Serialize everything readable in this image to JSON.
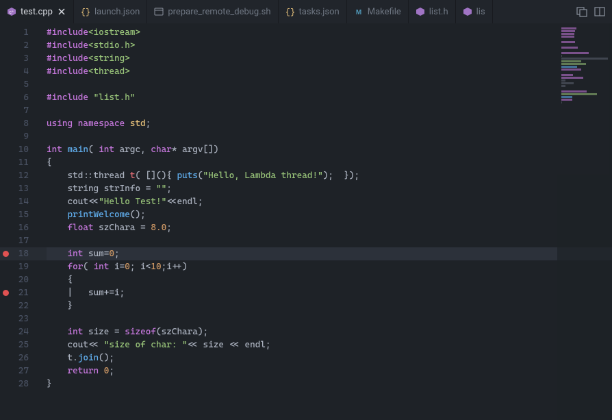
{
  "tabs": [
    {
      "label": "test.cpp",
      "icon": "cpp",
      "active": true,
      "closeable": true
    },
    {
      "label": "launch.json",
      "icon": "json",
      "active": false
    },
    {
      "label": "prepare_remote_debug.sh",
      "icon": "sh",
      "active": false
    },
    {
      "label": "tasks.json",
      "icon": "json",
      "active": false
    },
    {
      "label": "Makefile",
      "icon": "makefile",
      "active": false
    },
    {
      "label": "list.h",
      "icon": "cpp",
      "active": false
    },
    {
      "label": "lis",
      "icon": "cpp",
      "active": false
    }
  ],
  "editor": {
    "active_file": "test.cpp",
    "current_line": 18,
    "breakpoints": [
      18,
      21
    ],
    "line_count": 28,
    "code_lines": [
      {
        "n": 1,
        "tokens": [
          {
            "t": "#include",
            "c": "pre"
          },
          {
            "t": "<iostream>",
            "c": "hdr"
          }
        ]
      },
      {
        "n": 2,
        "tokens": [
          {
            "t": "#include",
            "c": "pre"
          },
          {
            "t": "<stdio.h>",
            "c": "hdr"
          }
        ]
      },
      {
        "n": 3,
        "tokens": [
          {
            "t": "#include",
            "c": "pre"
          },
          {
            "t": "<string>",
            "c": "hdr"
          }
        ]
      },
      {
        "n": 4,
        "tokens": [
          {
            "t": "#include",
            "c": "pre"
          },
          {
            "t": "<thread>",
            "c": "hdr"
          }
        ]
      },
      {
        "n": 5,
        "tokens": []
      },
      {
        "n": 6,
        "tokens": [
          {
            "t": "#include ",
            "c": "pre"
          },
          {
            "t": "\"list.h\"",
            "c": "hdr"
          }
        ]
      },
      {
        "n": 7,
        "tokens": []
      },
      {
        "n": 8,
        "tokens": [
          {
            "t": "using",
            "c": "kw"
          },
          {
            "t": " "
          },
          {
            "t": "namespace",
            "c": "kw"
          },
          {
            "t": " "
          },
          {
            "t": "std",
            "c": "ylw"
          },
          {
            "t": ";"
          }
        ]
      },
      {
        "n": 9,
        "tokens": []
      },
      {
        "n": 10,
        "tokens": [
          {
            "t": "int",
            "c": "kw"
          },
          {
            "t": " "
          },
          {
            "t": "main",
            "c": "fn"
          },
          {
            "t": "( "
          },
          {
            "t": "int",
            "c": "kw"
          },
          {
            "t": " argc, "
          },
          {
            "t": "char",
            "c": "kw"
          },
          {
            "t": "* argv[])"
          }
        ]
      },
      {
        "n": 11,
        "tokens": [
          {
            "t": "{"
          }
        ]
      },
      {
        "n": 12,
        "tokens": [
          {
            "t": "    std::thread "
          },
          {
            "t": "t",
            "c": "var"
          },
          {
            "t": "( [](){ "
          },
          {
            "t": "puts",
            "c": "fn"
          },
          {
            "t": "("
          },
          {
            "t": "\"Hello, Lambda thread!\"",
            "c": "str"
          },
          {
            "t": ");  });"
          }
        ]
      },
      {
        "n": 13,
        "tokens": [
          {
            "t": "    string strInfo = "
          },
          {
            "t": "\"\"",
            "c": "str"
          },
          {
            "t": ";"
          }
        ]
      },
      {
        "n": 14,
        "tokens": [
          {
            "t": "    cout<<"
          },
          {
            "t": "\"Hello Test!\"",
            "c": "str"
          },
          {
            "t": "<<endl;"
          }
        ]
      },
      {
        "n": 15,
        "tokens": [
          {
            "t": "    "
          },
          {
            "t": "printWelcome",
            "c": "fn"
          },
          {
            "t": "();"
          }
        ]
      },
      {
        "n": 16,
        "tokens": [
          {
            "t": "    "
          },
          {
            "t": "float",
            "c": "kw"
          },
          {
            "t": " szChara = "
          },
          {
            "t": "8.0",
            "c": "num"
          },
          {
            "t": ";"
          }
        ]
      },
      {
        "n": 17,
        "tokens": []
      },
      {
        "n": 18,
        "tokens": [
          {
            "t": "    "
          },
          {
            "t": "int",
            "c": "kw"
          },
          {
            "t": " sum="
          },
          {
            "t": "0",
            "c": "num"
          },
          {
            "t": ";"
          }
        ]
      },
      {
        "n": 19,
        "tokens": [
          {
            "t": "    "
          },
          {
            "t": "for",
            "c": "kw"
          },
          {
            "t": "( "
          },
          {
            "t": "int",
            "c": "kw"
          },
          {
            "t": " i="
          },
          {
            "t": "0",
            "c": "num"
          },
          {
            "t": "; i<"
          },
          {
            "t": "10",
            "c": "num"
          },
          {
            "t": ";i++)"
          }
        ]
      },
      {
        "n": 20,
        "tokens": [
          {
            "t": "    {"
          }
        ]
      },
      {
        "n": 21,
        "tokens": [
          {
            "t": "    "
          },
          {
            "t": "|",
            "c": "op"
          },
          {
            "t": "   sum+=i;"
          }
        ]
      },
      {
        "n": 22,
        "tokens": [
          {
            "t": "    }"
          }
        ]
      },
      {
        "n": 23,
        "tokens": []
      },
      {
        "n": 24,
        "tokens": [
          {
            "t": "    "
          },
          {
            "t": "int",
            "c": "kw"
          },
          {
            "t": " size = "
          },
          {
            "t": "sizeof",
            "c": "kw"
          },
          {
            "t": "(szChara);"
          }
        ]
      },
      {
        "n": 25,
        "tokens": [
          {
            "t": "    cout<< "
          },
          {
            "t": "\"size of char: \"",
            "c": "str"
          },
          {
            "t": "<< size << endl;"
          }
        ]
      },
      {
        "n": 26,
        "tokens": [
          {
            "t": "    t."
          },
          {
            "t": "join",
            "c": "fn"
          },
          {
            "t": "();"
          }
        ]
      },
      {
        "n": 27,
        "tokens": [
          {
            "t": "    "
          },
          {
            "t": "return",
            "c": "kw"
          },
          {
            "t": " "
          },
          {
            "t": "0",
            "c": "num"
          },
          {
            "t": ";"
          }
        ]
      },
      {
        "n": 28,
        "tokens": [
          {
            "t": "}"
          }
        ]
      }
    ]
  },
  "icons": {
    "cpp_color": "#519aba",
    "json_color": "#e5c07b",
    "sh_color": "#8a919d",
    "makefile_color": "#519aba"
  }
}
